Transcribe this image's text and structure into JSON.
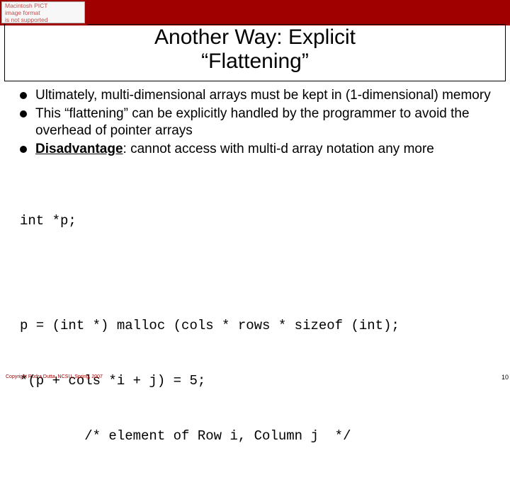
{
  "pict_badge": {
    "line1": "Macintosh PICT",
    "line2": "image format",
    "line3": "is not supported"
  },
  "title": {
    "line1": "Another Way: Explicit",
    "line2": "“Flattening”"
  },
  "bullets": [
    {
      "text": "Ultimately, multi-dimensional arrays must be kept in (1-dimensional) memory"
    },
    {
      "text": "This “flattening” can be explicitly handled by the programmer to avoid the overhead of pointer arrays"
    },
    {
      "label": "Disadvantage",
      "rest": ": cannot access with multi-d array notation any more"
    }
  ],
  "code": {
    "l1": "int *p;",
    "l2": "p = (int *) malloc (cols * rows * sizeof (int);",
    "l3": "*(p + cols *i + j) = 5;",
    "l4": "        /* element of Row i, Column j  */"
  },
  "footer": "Copyright Rudra Dutta, NCSU, Spring, 2007",
  "page_number": "10"
}
